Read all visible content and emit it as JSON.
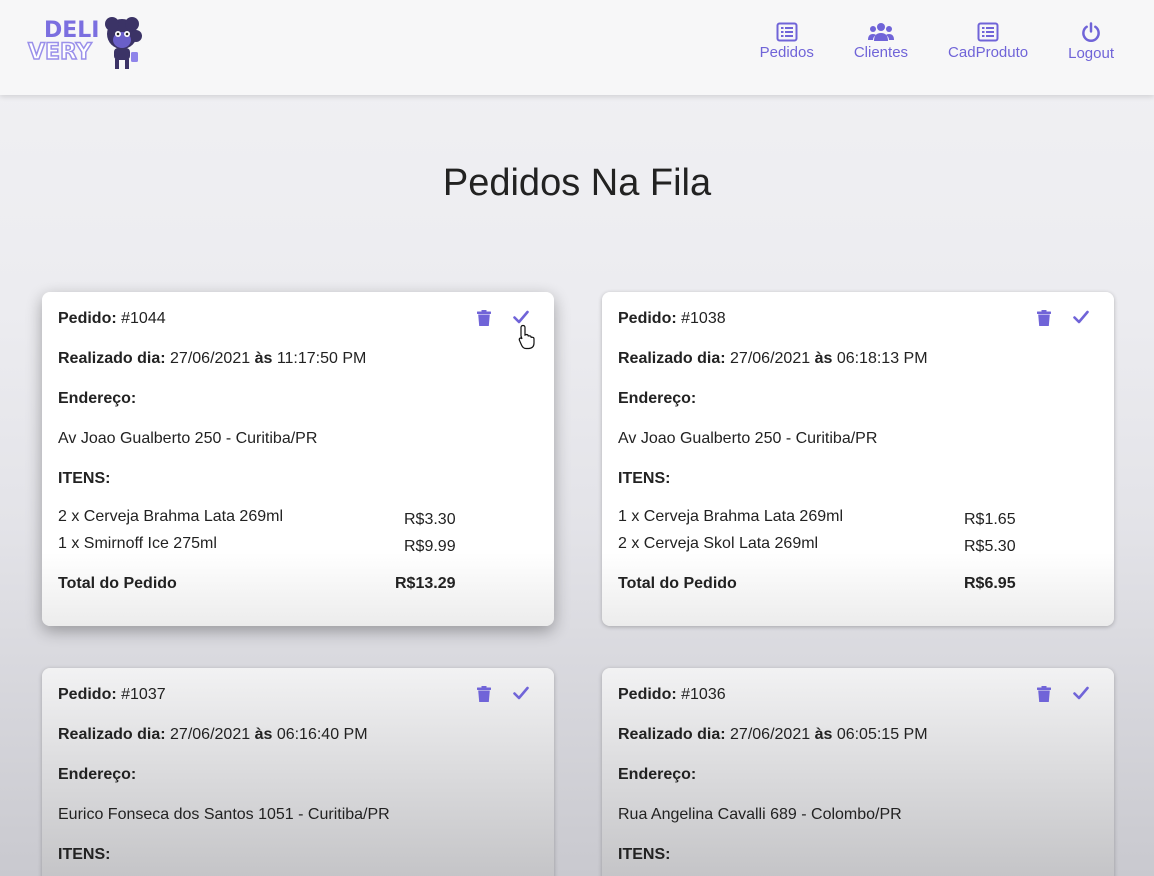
{
  "brand": {
    "line1": "DELI",
    "line2": "VERY"
  },
  "nav": [
    {
      "label": "Pedidos",
      "icon": "list-icon"
    },
    {
      "label": "Clientes",
      "icon": "users-icon"
    },
    {
      "label": "CadProduto",
      "icon": "list-icon"
    },
    {
      "label": "Logout",
      "icon": "power-icon"
    }
  ],
  "page_title": "Pedidos Na Fila",
  "labels": {
    "pedido": "Pedido:",
    "realizado": "Realizado dia:",
    "as": "às",
    "endereco": "Endereço:",
    "itens": "ITENS:",
    "total": "Total do Pedido"
  },
  "accent_color": "#7064d8",
  "orders": [
    {
      "id": "#1044",
      "date": "27/06/2021",
      "time": "11:17:50 PM",
      "address": "Av Joao Gualberto 250 - Curitiba/PR",
      "items": [
        {
          "desc": "2 x Cerveja Brahma Lata 269ml",
          "price": "R$3.30"
        },
        {
          "desc": "1 x Smirnoff Ice 275ml",
          "price": "R$9.99"
        }
      ],
      "total": "R$13.29"
    },
    {
      "id": "#1038",
      "date": "27/06/2021",
      "time": "06:18:13 PM",
      "address": "Av Joao Gualberto 250 - Curitiba/PR",
      "items": [
        {
          "desc": "1 x Cerveja Brahma Lata 269ml",
          "price": "R$1.65"
        },
        {
          "desc": "2 x Cerveja Skol Lata 269ml",
          "price": "R$5.30"
        }
      ],
      "total": "R$6.95"
    },
    {
      "id": "#1037",
      "date": "27/06/2021",
      "time": "06:16:40 PM",
      "address": "Eurico Fonseca dos Santos 1051 - Curitiba/PR"
    },
    {
      "id": "#1036",
      "date": "27/06/2021",
      "time": "06:05:15 PM",
      "address": "Rua Angelina Cavalli 689 - Colombo/PR"
    }
  ]
}
